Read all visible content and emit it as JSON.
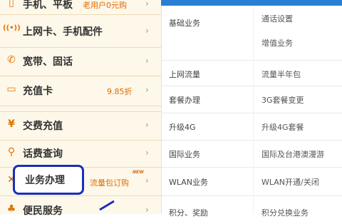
{
  "left_menu": {
    "items": [
      {
        "icon": "mobile-icon",
        "glyph": "▯",
        "label": "手机、平板",
        "extra": "老用户0元购"
      },
      {
        "icon": "signal-icon",
        "glyph": "((•))",
        "label": "上网卡、手机配件",
        "extra": ""
      },
      {
        "icon": "phone-icon",
        "glyph": "✆",
        "label": "宽带、固话",
        "extra": ""
      },
      {
        "icon": "card-icon",
        "glyph": "▭",
        "label": "充值卡",
        "extra": "9.85折"
      },
      {
        "icon": "yuan-icon",
        "glyph": "¥",
        "label": "交费充值",
        "extra": ""
      },
      {
        "icon": "search-icon",
        "glyph": "⚲",
        "label": "话费查询",
        "extra": ""
      },
      {
        "icon": "tools-icon",
        "glyph": "✕",
        "label": "业务办理",
        "extra": "流量包订购",
        "badge": "NEW"
      },
      {
        "icon": "service-icon",
        "glyph": "♣",
        "label": "便民服务",
        "extra": ""
      }
    ]
  },
  "right_panel": {
    "rows": [
      {
        "category": "基础业务",
        "links": [
          "通话设置",
          "增值业务"
        ]
      },
      {
        "category": "上网流量",
        "links": [
          "流量半年包"
        ]
      },
      {
        "category": "套餐办理",
        "links": [
          "3G套餐变更"
        ]
      },
      {
        "category": "升级4G",
        "links": [
          "升级4G套餐"
        ]
      },
      {
        "category": "国际业务",
        "links": [
          "国际及台港澳漫游"
        ]
      },
      {
        "category": "WLAN业务",
        "links": [
          "WLAN开通/关闭"
        ]
      },
      {
        "category": "积分、奖励",
        "links": [
          "积分兑换业务"
        ]
      }
    ]
  },
  "colors": {
    "accent": "#e07300",
    "highlight": "#1a2fb8",
    "topbar": "#2a7fd4"
  }
}
